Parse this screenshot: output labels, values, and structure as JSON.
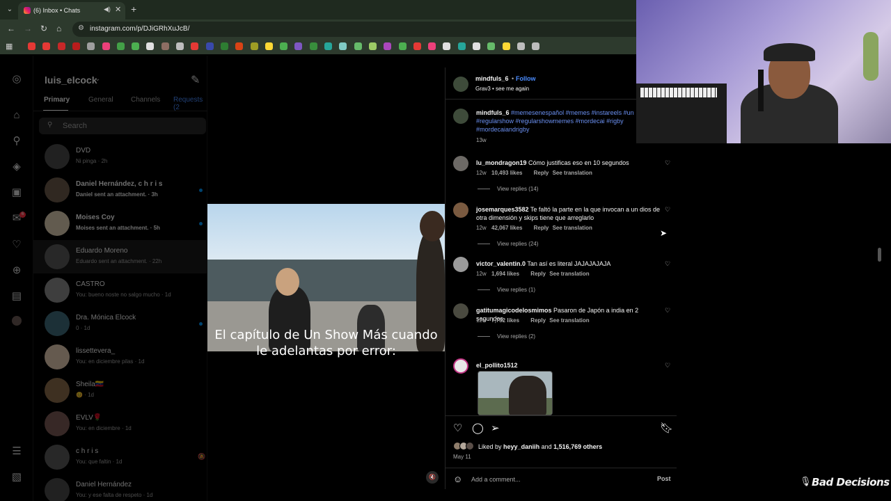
{
  "browser": {
    "tab_title": "(6) Inbox • Chats",
    "url": "instagram.com/p/DJiGRhXuJcB/",
    "bookmark_colors": [
      "#e53935",
      "#e53935",
      "#c62828",
      "#b71c1c",
      "#9e9e9e",
      "#ec407a",
      "#43a047",
      "#4caf50",
      "#e0e0e0",
      "#8d6e63",
      "#bdbdbd",
      "#e53935",
      "#3949ab",
      "#2e7d32",
      "#d84315",
      "#9e9d24",
      "#fdd835",
      "#4caf50",
      "#7e57c2",
      "#388e3c",
      "#26a69a",
      "#80cbc4",
      "#66bb6a",
      "#9ccc65",
      "#ab47bc",
      "#4caf50",
      "#e53935",
      "#ec407a",
      "#e0e0e0",
      "#26a69a",
      "#e0e0e0",
      "#66bb6a",
      "#fdd835",
      "#bdbdbd",
      "#bdbdbd"
    ]
  },
  "dm": {
    "username": "luis_elcock",
    "tabs": [
      "Primary",
      "General",
      "Channels",
      "Requests (2"
    ],
    "search_placeholder": "Search",
    "chats": [
      {
        "name": "DVD",
        "sub": "Ni pinga · 2h",
        "bold": false,
        "unread": false
      },
      {
        "name": "Daniel Hernández, c h r i s",
        "sub": "Daniel sent an attachment. · 3h",
        "bold": true,
        "unread": true
      },
      {
        "name": "Moises Coy",
        "sub": "Moises sent an attachment. · 5h",
        "bold": true,
        "unread": true
      },
      {
        "name": "Eduardo Moreno",
        "sub": "Eduardo sent an attachment. · 22h",
        "bold": false,
        "unread": false
      },
      {
        "name": "CASTRO",
        "sub": "You: bueno noste no salgo mucho · 1d",
        "bold": false,
        "unread": false
      },
      {
        "name": "Dra. Mónica Elcock",
        "sub": "0 · 1d",
        "bold": false,
        "unread": true
      },
      {
        "name": "lissettevera_",
        "sub": "You: en diciembre pilas · 1d",
        "bold": false,
        "unread": false
      },
      {
        "name": "Sheila🇻🇪",
        "sub": "😊 · 1d",
        "bold": false,
        "unread": false
      },
      {
        "name": "EVLV🌹",
        "sub": "You: en diciembre · 1d",
        "bold": false,
        "unread": false
      },
      {
        "name": "c h r i s",
        "sub": "You: que faltin · 1d",
        "bold": false,
        "unread": false
      },
      {
        "name": "Daniel Hernández",
        "sub": "You: y ese falta de respeto · 1d",
        "bold": false,
        "unread": false
      }
    ],
    "notification_count": "6"
  },
  "video": {
    "caption": "El capítulo de Un Show Más cuando le adelantas por error:"
  },
  "post": {
    "author": "mindfuls_6",
    "follow_label": "Follow",
    "audio": "Grav3 • see me again",
    "caption_user": "mindfuls_6",
    "caption_tags": "#memesenespañol #memes #instareels #un #regularshow #regularshowmemes #mordecai #rigby #mordecaiandrigby",
    "caption_age": "13w",
    "comments": [
      {
        "user": "lu_mondragon19",
        "text": "Cómo justificas eso en 10 segundos",
        "age": "12w",
        "likes": "10,493 likes",
        "reply": "Reply",
        "translate": "See translation",
        "replies": "View replies (14)"
      },
      {
        "user": "josemarques3582",
        "text": "Te faltó la parte en la que invocan a un dios de otra dimensión y skips tiene que arreglarlo",
        "age": "12w",
        "likes": "42,067 likes",
        "reply": "Reply",
        "translate": "See translation",
        "replies": "View replies (24)"
      },
      {
        "user": "victor_valentin.0",
        "text": "Tan así es literal JAJAJAJAJA",
        "age": "12w",
        "likes": "1,694 likes",
        "reply": "Reply",
        "translate": "See translation",
        "replies": "View replies (1)"
      },
      {
        "user": "gatitumagicodelosmimos",
        "text": "Pasaron de Japón a india en 2 segundos",
        "age": "12w",
        "likes": "7,752 likes",
        "reply": "Reply",
        "translate": "See translation",
        "replies": "View replies (2)"
      },
      {
        "user": "el_pollito1512",
        "text": "",
        "age": "",
        "likes": "",
        "reply": "",
        "translate": "",
        "replies": ""
      }
    ],
    "liked_by_prefix": "Liked by",
    "liked_by_user": "heyy_daniih",
    "liked_by_and": "and",
    "liked_by_others": "1,516,769 others",
    "date": "May 11",
    "comment_placeholder": "Add a comment...",
    "post_label": "Post"
  },
  "stream": {
    "brand": "Bad Decisions"
  }
}
